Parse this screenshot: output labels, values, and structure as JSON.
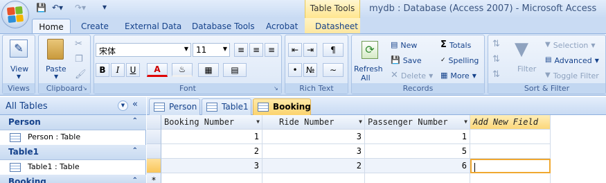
{
  "window": {
    "title": "mydb : Database (Access 2007) - Microsoft Access",
    "context_group": "Table Tools"
  },
  "quick_access": {
    "more": "▾"
  },
  "ribbon_tabs": [
    {
      "label": "Home"
    },
    {
      "label": "Create"
    },
    {
      "label": "External Data"
    },
    {
      "label": "Database Tools"
    },
    {
      "label": "Acrobat"
    },
    {
      "label": "Datasheet"
    }
  ],
  "ribbon": {
    "views": {
      "group": "Views",
      "view": "View"
    },
    "clipboard": {
      "group": "Clipboard",
      "paste": "Paste"
    },
    "font": {
      "group": "Font",
      "family": "宋体",
      "size": "11",
      "bold": "B",
      "italic": "I",
      "underline": "U",
      "font_color": "A"
    },
    "rich_text": {
      "group": "Rich Text"
    },
    "records": {
      "group": "Records",
      "refresh": "Refresh",
      "refresh_sub": "All",
      "new": "New",
      "save": "Save",
      "delete": "Delete",
      "totals": "Totals",
      "spelling": "Spelling",
      "more": "More"
    },
    "sort_filter": {
      "group": "Sort & Filter",
      "filter": "Filter",
      "selection": "Selection",
      "advanced": "Advanced",
      "toggle_filter": "Toggle Filter"
    }
  },
  "nav_pane": {
    "header": "All Tables",
    "groups": [
      {
        "name": "Person",
        "items": [
          {
            "label": "Person : Table"
          }
        ]
      },
      {
        "name": "Table1",
        "items": [
          {
            "label": "Table1 : Table"
          }
        ]
      },
      {
        "name": "Booking",
        "items": []
      }
    ]
  },
  "doc_tabs": [
    {
      "label": "Person",
      "active": false
    },
    {
      "label": "Table1",
      "active": false
    },
    {
      "label": "Booking",
      "active": true
    }
  ],
  "datasheet": {
    "columns": [
      "Booking Number",
      "Ride Number",
      "Passenger Number",
      "Add New Field"
    ],
    "rows": [
      [
        "1",
        "3",
        "1"
      ],
      [
        "2",
        "3",
        "5"
      ],
      [
        "3",
        "2",
        "6"
      ]
    ],
    "new_row_marker": "*"
  },
  "colors": {
    "accent": "#15428b",
    "active_tab": "#fbd36e",
    "ribbon_bg": "#dbe7f7"
  }
}
